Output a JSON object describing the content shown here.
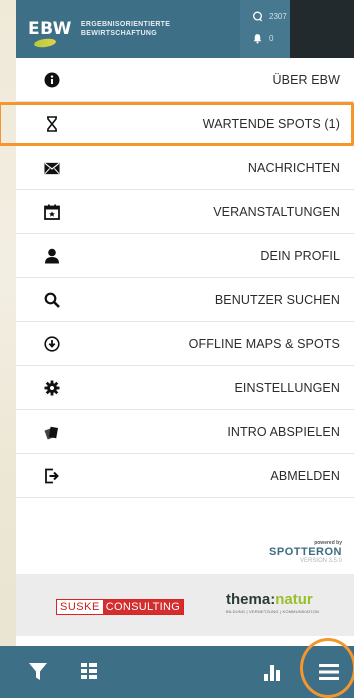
{
  "header": {
    "logo_mark": "EBW",
    "logo_line1": "ERGEBNISORIENTIERTE",
    "logo_line2": "BEWIRTSCHAFTUNG",
    "spot_count": "2307",
    "notification_count": "0"
  },
  "menu": {
    "items": [
      {
        "label": "ÜBER EBW",
        "icon": "info-icon"
      },
      {
        "label": "WARTENDE SPOTS (1)",
        "icon": "hourglass-icon",
        "highlighted": true
      },
      {
        "label": "NACHRICHTEN",
        "icon": "envelope-icon"
      },
      {
        "label": "VERANSTALTUNGEN",
        "icon": "calendar-star-icon"
      },
      {
        "label": "DEIN PROFIL",
        "icon": "user-icon"
      },
      {
        "label": "BENUTZER SUCHEN",
        "icon": "search-icon"
      },
      {
        "label": "OFFLINE MAPS & SPOTS",
        "icon": "download-circle-icon"
      },
      {
        "label": "EINSTELLUNGEN",
        "icon": "gear-icon"
      },
      {
        "label": "INTRO ABSPIELEN",
        "icon": "cards-icon"
      },
      {
        "label": "ABMELDEN",
        "icon": "logout-icon"
      }
    ]
  },
  "powered": {
    "powered_by": "powered by",
    "brand": "SPOTTERON",
    "version": "VERSION 3.5.0"
  },
  "sponsors": {
    "suske_a": "SUSKE",
    "suske_b": "CONSULTING",
    "thema_a": "thema",
    "thema_colon": ":",
    "thema_b": "natur",
    "thema_tag": "BILDUNG | VERNETZUNG | KOMMUNIKATION"
  },
  "bottom_bar": {
    "icons": [
      "filter-icon",
      "legend-icon",
      "chart-icon",
      "menu-icon"
    ]
  },
  "colors": {
    "brand_blue": "#3d6f87",
    "highlight_orange": "#f5962c",
    "dark": "#232a2e"
  }
}
